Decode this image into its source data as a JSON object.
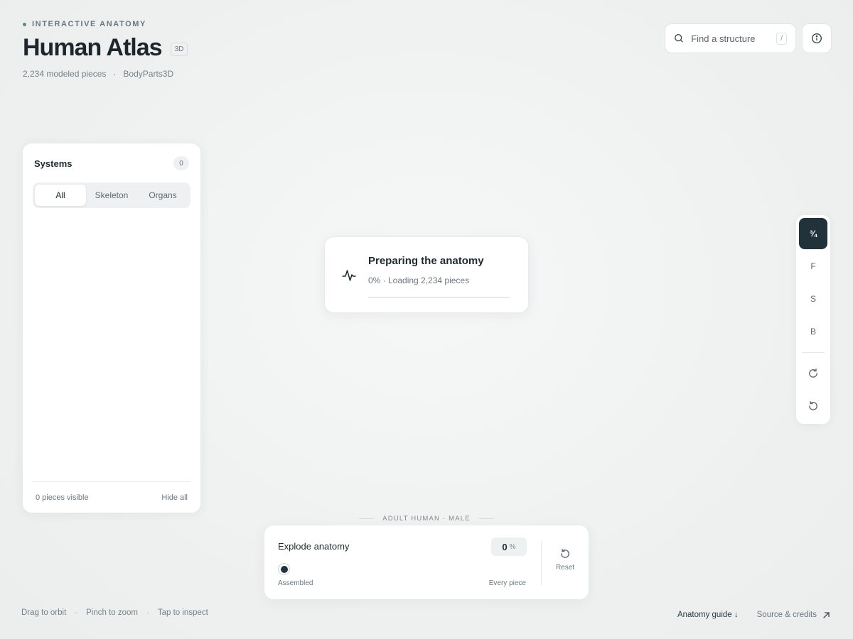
{
  "header": {
    "eyebrow": "INTERACTIVE ANATOMY",
    "title": "Human Atlas",
    "badge": "3D",
    "meta_pieces": "2,234 modeled pieces",
    "meta_sep": "·",
    "meta_source": "BodyParts3D"
  },
  "search": {
    "placeholder": "Find a structure",
    "shortcut": "/"
  },
  "systems": {
    "title": "Systems",
    "count": "0",
    "tabs": [
      "All",
      "Skeleton",
      "Organs"
    ],
    "active_tab": "All",
    "visible_text": "0 pieces visible",
    "hide_all": "Hide all"
  },
  "loader": {
    "title": "Preparing the anatomy",
    "status": "0% · Loading 2,234 pieces",
    "progress": 0
  },
  "view_rail": {
    "buttons": [
      "¾",
      "F",
      "S",
      "B"
    ],
    "active": "¾"
  },
  "explode": {
    "caption": "ADULT HUMAN · MALE",
    "title": "Explode anatomy",
    "value": "0",
    "unit": "%",
    "min_label": "Assembled",
    "max_label": "Every piece",
    "reset_label": "Reset"
  },
  "footer": {
    "hints": [
      "Drag to orbit",
      "Pinch to zoom",
      "Tap to inspect"
    ],
    "hint_sep": "·",
    "guide": "Anatomy guide ↓",
    "credits": "Source & credits"
  },
  "colors": {
    "accent_dark": "#22323b",
    "eyebrow_dot": "#4e8f7e"
  }
}
